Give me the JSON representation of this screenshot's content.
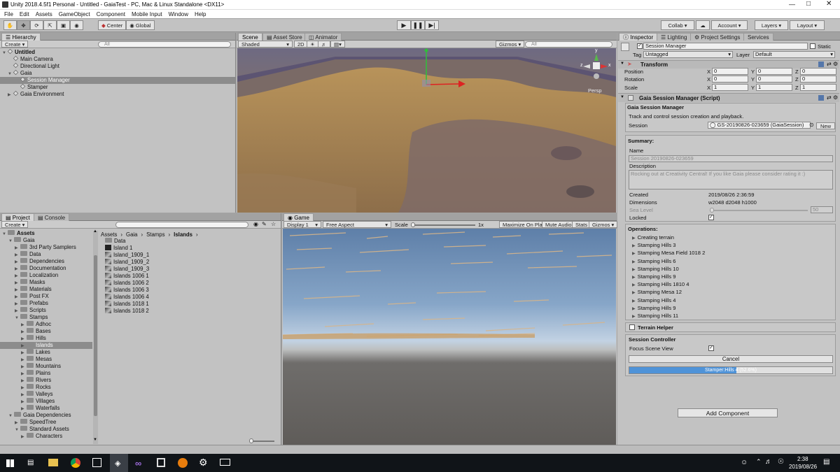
{
  "window": {
    "title": "Unity 2018.4.5f1 Personal - Untitled - GaiaTest - PC, Mac & Linux Standalone <DX11>"
  },
  "menu": [
    "File",
    "Edit",
    "Assets",
    "GameObject",
    "Component",
    "Mobile Input",
    "Window",
    "Help"
  ],
  "toolbar": {
    "center": "Center",
    "global": "Global",
    "collab": "Collab",
    "account": "Account",
    "layers": "Layers",
    "layout": "Layout"
  },
  "hierarchy": {
    "tab": "Hierarchy",
    "create": "Create",
    "search": "All",
    "scene": "Untitled",
    "items": [
      "Main Camera",
      "Directional Light",
      "Gaia",
      "Session Manager",
      "Stamper",
      "Gaia Environment"
    ]
  },
  "scene": {
    "tabs": [
      "Scene",
      "Asset Store",
      "Animator"
    ],
    "shading": "Shaded",
    "mode2d": "2D",
    "gizmos": "Gizmos",
    "search": "All",
    "persp": "Persp",
    "axes": {
      "y": "y",
      "x": "x",
      "z": "z"
    }
  },
  "project": {
    "tabs": [
      "Project",
      "Console"
    ],
    "create": "Create",
    "breadcrumb": [
      "Assets",
      "Gaia",
      "Stamps",
      "Islands"
    ],
    "tree": [
      {
        "label": "Assets",
        "depth": 0,
        "bold": true
      },
      {
        "label": "Gaia",
        "depth": 1
      },
      {
        "label": "3rd Party Samplers",
        "depth": 2
      },
      {
        "label": "Data",
        "depth": 2
      },
      {
        "label": "Dependencies",
        "depth": 2
      },
      {
        "label": "Documentation",
        "depth": 2
      },
      {
        "label": "Localization",
        "depth": 2
      },
      {
        "label": "Masks",
        "depth": 2
      },
      {
        "label": "Materials",
        "depth": 2
      },
      {
        "label": "Post FX",
        "depth": 2
      },
      {
        "label": "Prefabs",
        "depth": 2
      },
      {
        "label": "Scripts",
        "depth": 2
      },
      {
        "label": "Stamps",
        "depth": 2
      },
      {
        "label": "Adhoc",
        "depth": 3
      },
      {
        "label": "Bases",
        "depth": 3
      },
      {
        "label": "Hills",
        "depth": 3
      },
      {
        "label": "Islands",
        "depth": 3,
        "selected": true
      },
      {
        "label": "Lakes",
        "depth": 3
      },
      {
        "label": "Mesas",
        "depth": 3
      },
      {
        "label": "Mountains",
        "depth": 3
      },
      {
        "label": "Plains",
        "depth": 3
      },
      {
        "label": "Rivers",
        "depth": 3
      },
      {
        "label": "Rocks",
        "depth": 3
      },
      {
        "label": "Valleys",
        "depth": 3
      },
      {
        "label": "Villages",
        "depth": 3
      },
      {
        "label": "Waterfalls",
        "depth": 3
      },
      {
        "label": "Gaia Dependencies",
        "depth": 1
      },
      {
        "label": "SpeedTree",
        "depth": 2
      },
      {
        "label": "Standard Assets",
        "depth": 2
      },
      {
        "label": "Characters",
        "depth": 3
      }
    ],
    "files": [
      "Data",
      "Island 1",
      "Island_1909_1",
      "Island_1909_2",
      "Island_1909_3",
      "Islands 1006 1",
      "Islands 1006 2",
      "Islands 1006 3",
      "Islands 1006 4",
      "Islands 1018 1",
      "Islands 1018 2"
    ]
  },
  "game": {
    "tab": "Game",
    "display": "Display 1",
    "aspect": "Free Aspect",
    "scale_label": "Scale",
    "scale_value": "1x",
    "buttons": [
      "Maximize On Play",
      "Mute Audio",
      "Stats",
      "Gizmos"
    ]
  },
  "inspector": {
    "tabs": [
      "Inspector",
      "Lighting",
      "Project Settings",
      "Services"
    ],
    "object_name": "Session Manager",
    "static": "Static",
    "tag_label": "Tag",
    "tag": "Untagged",
    "layer_label": "Layer",
    "layer": "Default",
    "transform": {
      "title": "Transform",
      "rows": [
        {
          "label": "Position",
          "x": "0",
          "y": "0",
          "z": "0"
        },
        {
          "label": "Rotation",
          "x": "0",
          "y": "0",
          "z": "0"
        },
        {
          "label": "Scale",
          "x": "1",
          "y": "1",
          "z": "1"
        }
      ]
    },
    "script": {
      "title": "Gaia Session Manager (Script)",
      "heading": "Gaia Session Manager",
      "desc": "Track and control session creation and playback.",
      "session_label": "Session",
      "session_value": "GS-20190826-023659 (GaiaSession)",
      "new_btn": "New"
    },
    "summary": {
      "heading": "Summary:",
      "name_label": "Name",
      "name_value": "Session 20190826-023659",
      "desc_label": "Description",
      "desc_value": "Rocking out at Creativity Central! If you like Gaia please consider rating it :)",
      "created_label": "Created",
      "created_value": "2019/08/26 2:36:59",
      "dims_label": "Dimensions",
      "dims_value": "w2048 d2048 h1000",
      "sea_label": "Sea Level",
      "sea_value": "50",
      "locked_label": "Locked"
    },
    "operations": {
      "heading": "Operations:",
      "items": [
        "Creating terrain",
        "Stamping Hills 3",
        "Stamping Mesa Field 1018 2",
        "Stamping Hills 6",
        "Stamping Hills 10",
        "Stamping Hills 9",
        "Stamping Hills 1810 4",
        "Stamping Mesa 12",
        "Stamping Hills 4",
        "Stamping Hills 9",
        "Stamping Hills 11"
      ]
    },
    "terrain_helper": "Terrain Helper",
    "controller": {
      "heading": "Session Controller",
      "focus_label": "Focus Scene View",
      "cancel": "Cancel",
      "progress_text": "Stamper:Hills 4 (52.6%)",
      "progress": 0.526
    },
    "add_component": "Add Component"
  },
  "taskbar": {
    "time": "2:38",
    "date": "2019/08/26"
  }
}
